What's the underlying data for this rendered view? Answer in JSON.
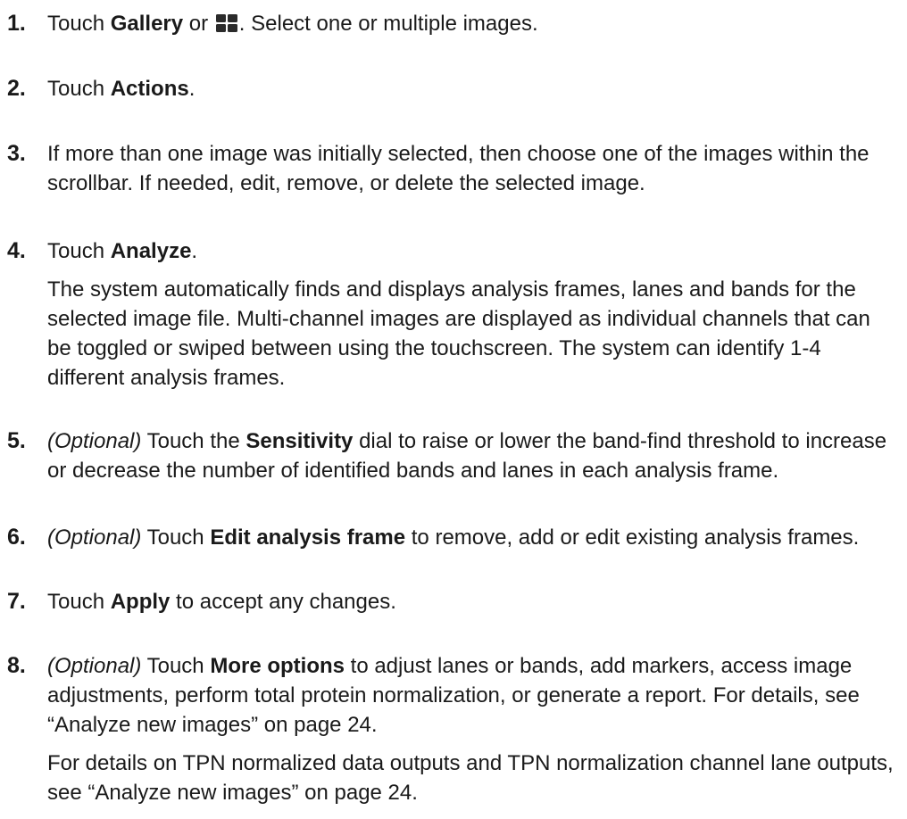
{
  "steps": [
    {
      "number": "1.",
      "paragraphs": [
        [
          {
            "t": "Touch ",
            "s": ""
          },
          {
            "t": "Gallery",
            "s": "bold"
          },
          {
            "t": " or ",
            "s": ""
          },
          {
            "icon": "gallery-grid-icon"
          },
          {
            "t": ". Select one or multiple images.",
            "s": ""
          }
        ]
      ]
    },
    {
      "number": "2.",
      "paragraphs": [
        [
          {
            "t": "Touch ",
            "s": ""
          },
          {
            "t": "Actions",
            "s": "bold"
          },
          {
            "t": ".",
            "s": ""
          }
        ]
      ]
    },
    {
      "number": "3.",
      "paragraphs": [
        [
          {
            "t": "If more than one image was initially selected, then choose one of the images within the scrollbar. If needed, edit, remove, or delete the selected image.",
            "s": ""
          }
        ]
      ]
    },
    {
      "number": "4.",
      "paragraphs": [
        [
          {
            "t": "Touch ",
            "s": ""
          },
          {
            "t": "Analyze",
            "s": "bold"
          },
          {
            "t": ".",
            "s": ""
          }
        ],
        [
          {
            "t": "The system automatically finds and displays analysis frames, lanes and bands for the selected image file. Multi-channel images are displayed as individual channels that can be toggled or swiped between using the touchscreen. The system can identify 1-4 different analysis frames.",
            "s": ""
          }
        ]
      ]
    },
    {
      "number": "5.",
      "paragraphs": [
        [
          {
            "t": "(Optional)",
            "s": "italic"
          },
          {
            "t": " Touch the ",
            "s": ""
          },
          {
            "t": "Sensitivity",
            "s": "bold"
          },
          {
            "t": " dial to raise or lower the band-find threshold to increase or decrease the number of identified bands and lanes in each analysis frame.",
            "s": ""
          }
        ]
      ]
    },
    {
      "number": "6.",
      "paragraphs": [
        [
          {
            "t": "(Optional)",
            "s": "italic"
          },
          {
            "t": " Touch ",
            "s": ""
          },
          {
            "t": "Edit analysis frame",
            "s": "bold"
          },
          {
            "t": " to remove, add or edit existing analysis frames.",
            "s": ""
          }
        ]
      ]
    },
    {
      "number": "7.",
      "paragraphs": [
        [
          {
            "t": "Touch ",
            "s": ""
          },
          {
            "t": "Apply",
            "s": "bold"
          },
          {
            "t": " to accept any changes.",
            "s": ""
          }
        ]
      ]
    },
    {
      "number": "8.",
      "paragraphs": [
        [
          {
            "t": "(Optional)",
            "s": "italic"
          },
          {
            "t": " Touch ",
            "s": ""
          },
          {
            "t": "More options",
            "s": "bold"
          },
          {
            "t": " to adjust lanes or bands, add markers, access image adjustments, perform total protein normalization, or generate a report. For details, see “Analyze new images” on page 24.",
            "s": ""
          }
        ],
        [
          {
            "t": "For details on TPN normalized data outputs and TPN normalization channel lane outputs, see “Analyze new images” on page 24.",
            "s": ""
          }
        ]
      ]
    }
  ],
  "colors": {
    "text": "#1a1a1a",
    "icon": "#2b2b2b"
  }
}
